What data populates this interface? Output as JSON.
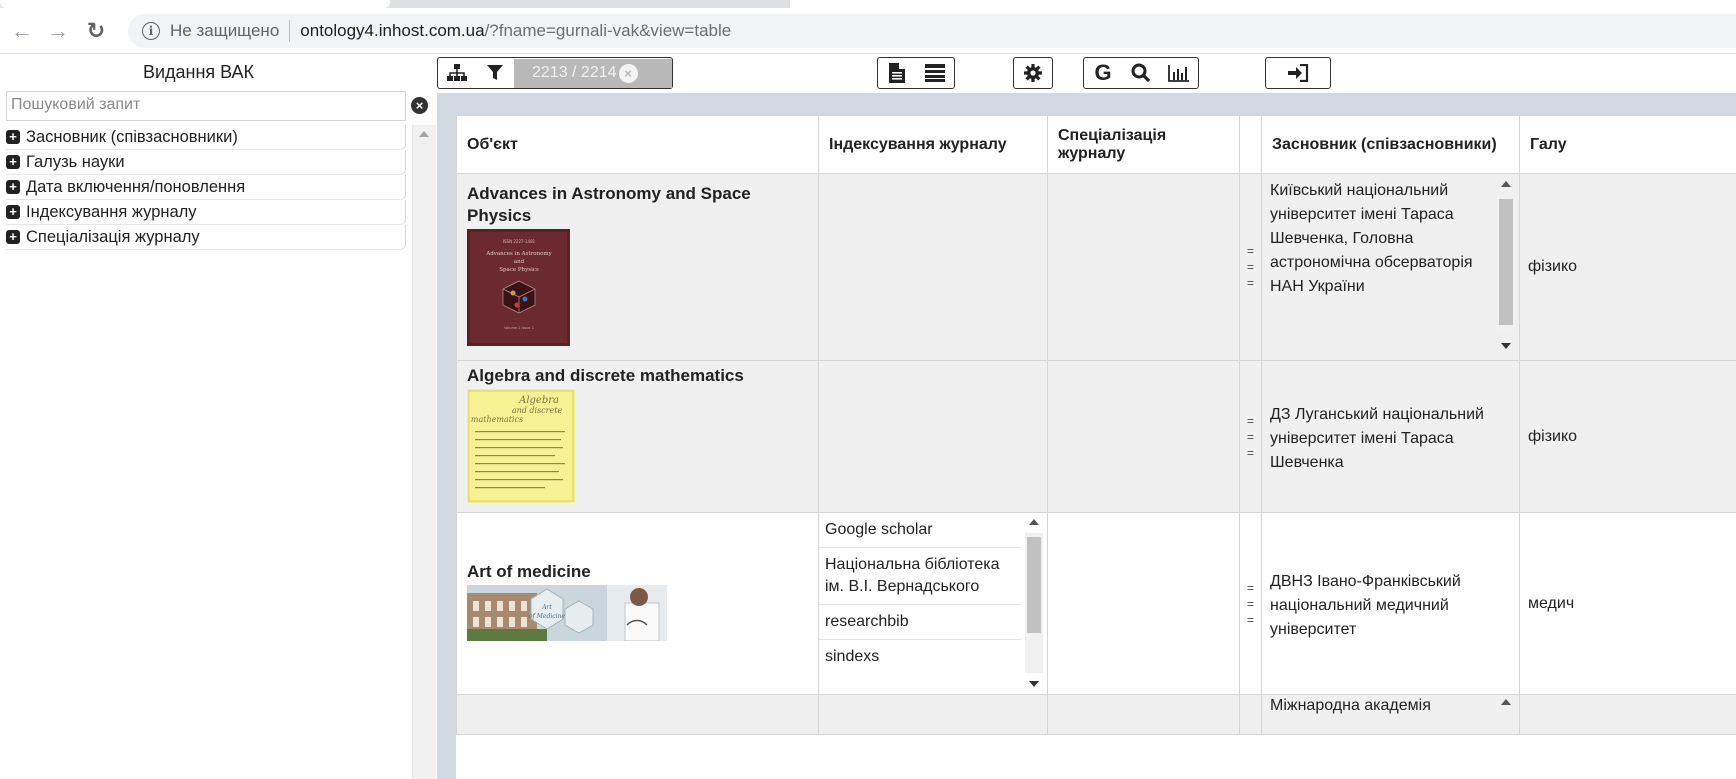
{
  "browser": {
    "insecure_label": "Не защищено",
    "url_host": "ontology4.inhost.com.ua",
    "url_path": "/?fname=gurnali-vak&view=table"
  },
  "sidebar": {
    "app_title": "Видання ВАК",
    "search_placeholder": "Пошуковий запит",
    "facets": [
      {
        "label": "Засновник (співзасновники)"
      },
      {
        "label": "Галузь науки"
      },
      {
        "label": "Дата включення/поновлення"
      },
      {
        "label": "Індексування журналу"
      },
      {
        "label": "Спеціалізація журналу"
      }
    ]
  },
  "toolbar": {
    "counter": "2213 / 2214"
  },
  "table": {
    "headers": {
      "object": "Об'єкт",
      "indexing": "Індексування журналу",
      "specialization": "Спеціалізація журналу",
      "founder": "Засновник (співзасновники)",
      "field": "Галу"
    },
    "rows": [
      {
        "title": "Advances in Astronomy and Space Physics",
        "cover_text": "Advances in Astronomy and Space Physics",
        "indexing": [],
        "specialization": "",
        "founder": "Київський національний університет імені Тараса Шевченка, Головна астрономічна обсерваторія НАН України",
        "field": "фізико"
      },
      {
        "title": "Algebra and discrete mathematics",
        "cover_text": "Algebra and discrete mathematics",
        "indexing": [],
        "specialization": "",
        "founder": "ДЗ Луганський національний університет імені Тараса Шевченка",
        "field": "фізико"
      },
      {
        "title": "Art of medicine",
        "cover_text": "Art of Medicine",
        "indexing": [
          "Google scholar",
          "Національна бібліотека ім. В.І. Вернадського",
          "researchbib",
          "sindexs"
        ],
        "specialization": "",
        "founder": "ДВНЗ Івано-Франківський національний медичний університет",
        "field": "медич"
      },
      {
        "title": "",
        "indexing": [],
        "specialization": "",
        "founder": "Міжнародна академія",
        "field": ""
      }
    ]
  }
}
